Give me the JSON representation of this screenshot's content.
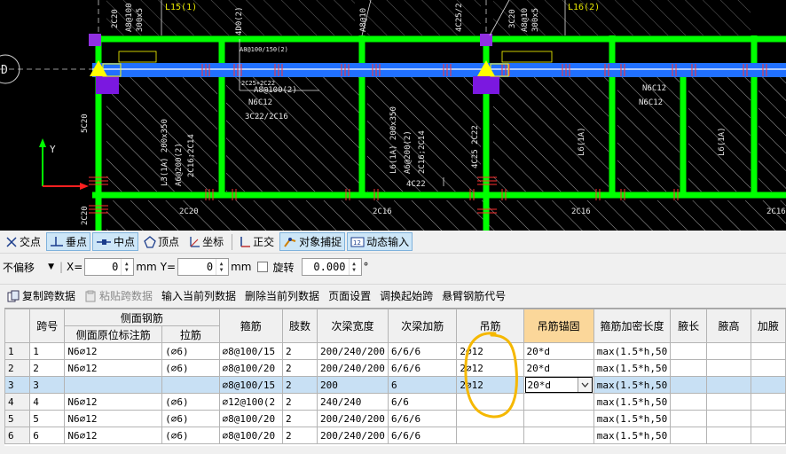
{
  "cad": {
    "axis_label": "D",
    "y_label": "Y",
    "beam_labels": [
      "L15(1)",
      "L16(2)"
    ],
    "top_texts": [
      "2C20",
      "A8@100",
      "300x5",
      "A8@10",
      "4C25/2",
      "3C20",
      "A8@10",
      "300x5",
      "4D0(2)"
    ],
    "annotations": [
      "A8@100/150(2)",
      "2C25+2C22",
      "A8@100(2)",
      "N6C12",
      "3C22/2C16",
      "4C22",
      "N6C12",
      "N6C12"
    ],
    "vertical_texts": [
      "L3(1A) 200x350",
      "A6@200(2)",
      "2C16;2C14",
      "L6(1A) 200x350",
      "A6@200(2)",
      "2C16;2C14",
      "4C25 2C22",
      "L6(1A)",
      "L6(1A)"
    ],
    "bottom_texts": [
      "2C20",
      "2C16",
      "2C16",
      "2C16"
    ],
    "left_texts": [
      "5C20",
      "2C20"
    ],
    "colors": {
      "beam": "#00ff00",
      "slab": "#2070ff",
      "highlight_col": "#7b18e0",
      "marker": "#ffff00",
      "label": "#ffff33"
    }
  },
  "snapbar": {
    "items": [
      {
        "name": "intersection",
        "label": "交点",
        "icon": "cross-icon",
        "on": false
      },
      {
        "name": "perpendicular",
        "label": "垂点",
        "icon": "perpendicular-icon",
        "on": true
      },
      {
        "name": "midpoint",
        "label": "中点",
        "icon": "midpoint-icon",
        "on": true
      },
      {
        "name": "vertex",
        "label": "顶点",
        "icon": "vertex-icon",
        "on": false
      },
      {
        "name": "coordinate",
        "label": "坐标",
        "icon": "coordinate-icon",
        "on": false
      },
      {
        "name": "ortho",
        "label": "正交",
        "icon": "ortho-icon",
        "on": false
      },
      {
        "name": "object-snap",
        "label": "对象捕捉",
        "icon": "object-snap-icon",
        "on": true
      },
      {
        "name": "dynamic-input",
        "label": "动态输入",
        "icon": "dynamic-input-icon",
        "on": true
      }
    ]
  },
  "offsetbar": {
    "mode": "不偏移",
    "x_label": "X=",
    "x_value": "0",
    "unit1": "mm",
    "y_label": "Y=",
    "y_value": "0",
    "unit2": "mm",
    "rotate_label": "旋转",
    "rotate_value": "0.000",
    "degree": "°"
  },
  "toolbar2": {
    "copy": "复制跨数据",
    "paste": "粘贴跨数据",
    "input_col": "输入当前列数据",
    "delete_col": "删除当前列数据",
    "page_setup": "页面设置",
    "swap_start": "调换起始跨",
    "cantilever": "悬臂钢筋代号"
  },
  "table": {
    "group_header": "侧面钢筋",
    "headers": [
      "跨号",
      "侧面原位标注筋",
      "拉筋",
      "箍筋",
      "肢数",
      "次梁宽度",
      "次梁加筋",
      "吊筋",
      "吊筋锚固",
      "箍筋加密长度",
      "腋长",
      "腋高",
      "加腋"
    ],
    "rows": [
      {
        "num": "1",
        "span": "1",
        "side": "N6⌀12",
        "tie": "(⌀6)",
        "stirrup": "⌀8@100/15",
        "legs": "2",
        "width": "200/240/200",
        "add": "6/6/6",
        "hanger": "2⌀12",
        "anchor": "20*d",
        "dense": "max(1.5*h,50",
        "hl": "",
        "hh": "",
        "ha": ""
      },
      {
        "num": "2",
        "span": "2",
        "side": "N6⌀12",
        "tie": "(⌀6)",
        "stirrup": "⌀8@100/20",
        "legs": "2",
        "width": "200/240/200",
        "add": "6/6/6",
        "hanger": "2⌀12",
        "anchor": "20*d",
        "dense": "max(1.5*h,50",
        "hl": "",
        "hh": "",
        "ha": ""
      },
      {
        "num": "3",
        "span": "3",
        "side": "",
        "tie": "",
        "stirrup": "⌀8@100/15",
        "legs": "2",
        "width": "200",
        "add": "6",
        "hanger": "2⌀12",
        "anchor": "20*d",
        "dense": "max(1.5*h,50",
        "hl": "",
        "hh": "",
        "ha": ""
      },
      {
        "num": "4",
        "span": "4",
        "side": "N6⌀12",
        "tie": "(⌀6)",
        "stirrup": "⌀12@100(2",
        "legs": "2",
        "width": "240/240",
        "add": "6/6",
        "hanger": "",
        "anchor": "",
        "dense": "max(1.5*h,50",
        "hl": "",
        "hh": "",
        "ha": ""
      },
      {
        "num": "5",
        "span": "5",
        "side": "N6⌀12",
        "tie": "(⌀6)",
        "stirrup": "⌀8@100/20",
        "legs": "2",
        "width": "200/240/200",
        "add": "6/6/6",
        "hanger": "",
        "anchor": "",
        "dense": "max(1.5*h,50",
        "hl": "",
        "hh": "",
        "ha": ""
      },
      {
        "num": "6",
        "span": "6",
        "side": "N6⌀12",
        "tie": "(⌀6)",
        "stirrup": "⌀8@100/20",
        "legs": "2",
        "width": "200/240/200",
        "add": "6/6/6",
        "hanger": "",
        "anchor": "",
        "dense": "max(1.5*h,50",
        "hl": "",
        "hh": "",
        "ha": ""
      }
    ],
    "selected_row": 2,
    "active_column": "吊筋锚固"
  }
}
